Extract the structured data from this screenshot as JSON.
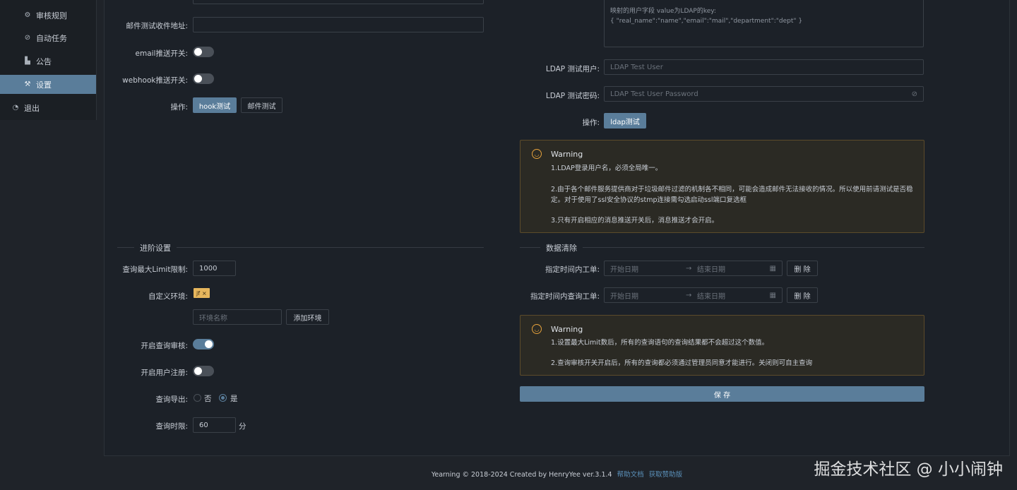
{
  "sidebar": {
    "items": [
      {
        "label": "审核规则",
        "icon": "gear-icon"
      },
      {
        "label": "自动任务",
        "icon": "paperclip-icon"
      },
      {
        "label": "公告",
        "icon": "chart-icon"
      },
      {
        "label": "设置",
        "icon": "wrench-icon",
        "active": true
      },
      {
        "label": "退出",
        "icon": "logout-icon"
      }
    ]
  },
  "mail": {
    "test_recipient_label": "邮件测试收件地址:",
    "email_switch_label": "email推送开关:",
    "webhook_switch_label": "webhook推送开关:",
    "ops_label": "操作:",
    "hook_test": "hook测试",
    "mail_test": "邮件测试"
  },
  "ldap": {
    "mapping_line1": "映射的用户字段 value为LDAP的key:",
    "mapping_line2": "{ \"real_name\":\"name\",\"email\":\"mail\",\"department\":\"dept\" }",
    "test_user_label": "LDAP 测试用户:",
    "test_user_placeholder": "LDAP Test User",
    "test_pass_label": "LDAP 测试密码:",
    "test_pass_placeholder": "LDAP Test User Password",
    "ops_label": "操作:",
    "ldap_test": "ldap测试"
  },
  "warning1": {
    "title": "Warning",
    "line1": "1.LDAP登录用户名，必须全局唯一。",
    "line2": "2.由于各个邮件服务提供商对于垃圾邮件过滤的机制各不相同，可能会造成邮件无法接收的情况。所以使用前请测试是否稳定。对于使用了ssl安全协议的stmp连接需勾选启动ssl端口复选框",
    "line3": "3.只有开启相应的消息推送开关后，消息推送才会开启。"
  },
  "advanced": {
    "title": "进阶设置",
    "limit_label": "查询最大Limit限制:",
    "limit_value": "1000",
    "env_label": "自定义环境:",
    "env_tag": "jf",
    "env_tag_close": "×",
    "env_name_placeholder": "环境名称",
    "add_env": "添加环境",
    "query_audit_label": "开启查询审核:",
    "user_register_label": "开启用户注册:",
    "export_label": "查询导出:",
    "export_no": "否",
    "export_yes": "是",
    "timeout_label": "查询时限:",
    "timeout_value": "60",
    "timeout_unit": "分"
  },
  "cleanup": {
    "title": "数据清除",
    "order_label": "指定时间内工单:",
    "query_label": "指定时间内查询工单:",
    "start_placeholder": "开始日期",
    "end_placeholder": "结束日期",
    "arrow": "→",
    "delete": "删 除"
  },
  "warning2": {
    "title": "Warning",
    "line1": "1.设置最大Limit数后，所有的查询语句的查询结果都不会超过这个数值。",
    "line2": "2.查询审核开关开启后，所有的查询都必须通过管理员同意才能进行。关闭则可自主查询"
  },
  "save": "保 存",
  "footer": {
    "text": "Yearning © 2018-2024 Created by HenryYee ver.3.1.4",
    "doc_link": "帮助文档",
    "sponsor_link": "获取赞助版"
  },
  "watermark": "掘金技术社区 @ 小小闹钟",
  "colors": {
    "accent": "#5a7d9a",
    "warning": "#e6a23c"
  }
}
